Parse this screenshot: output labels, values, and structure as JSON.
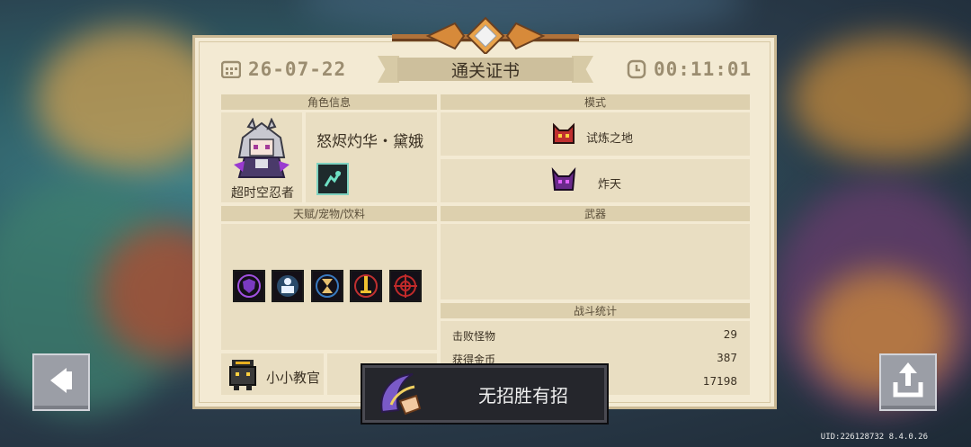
{
  "certificate": {
    "date": "26-07-22",
    "title": "通关证书",
    "time": "00:11:01"
  },
  "character": {
    "section_label": "角色信息",
    "name": "怒烬灼华・黛娥",
    "class_name": "超时空忍者",
    "skill_icon": "dash-skill-icon"
  },
  "mode": {
    "section_label": "模式",
    "items": [
      {
        "label": "试炼之地",
        "icon": "red-demon-helmet-icon"
      },
      {
        "label": "炸天",
        "icon": "purple-horned-mask-icon"
      }
    ]
  },
  "talents": {
    "section_label": "天赋/宠物/饮料",
    "icons": [
      "shield-buff-icon",
      "meditation-buff-icon",
      "hourglass-buff-icon",
      "sword-buff-icon",
      "crosshair-buff-icon"
    ],
    "pet_name": "小小教官"
  },
  "weapons": {
    "section_label": "武器"
  },
  "stats": {
    "section_label": "战斗统计",
    "rows": [
      {
        "label": "击败怪物",
        "value": "29"
      },
      {
        "label": "获得金币",
        "value": "387"
      },
      {
        "label": "",
        "value": "17198"
      }
    ]
  },
  "skill_banner": {
    "label": "无招胜有招"
  },
  "footer": {
    "uid": "UID:226128732 8.4.0.26"
  },
  "colors": {
    "card": "#f3ead3",
    "panel": "#e9dec2",
    "header": "#ddd0ae",
    "accent_gold": "#c07a2a"
  }
}
